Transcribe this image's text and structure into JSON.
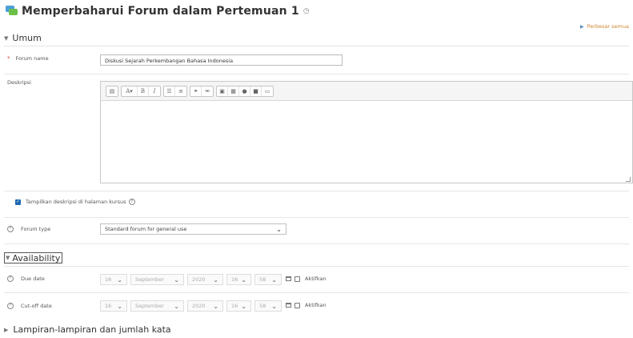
{
  "page": {
    "title": "Memperbaharui Forum dalam Pertemuan 1",
    "expand_all": "Perbesar semua"
  },
  "sections": {
    "general": {
      "label": "Umum"
    },
    "availability": {
      "label": "Availability"
    },
    "attachments": {
      "label": "Lampiran-lampiran dan jumlah kata"
    }
  },
  "form": {
    "forum_name": {
      "label": "Forum name",
      "value": "Diskusi Sejarah Perkembangan Bahasa Indonesia"
    },
    "description": {
      "label": "Deskripsi"
    },
    "show_description": {
      "label": "Tampilkan deskripsi di halaman kursus",
      "checked": true
    },
    "forum_type": {
      "label": "Forum type",
      "value": "Standard forum for general use"
    },
    "due_date": {
      "label": "Due date",
      "day": "16",
      "month": "September",
      "year": "2020",
      "hour": "16",
      "minute": "58",
      "enable_label": "Aktifkan",
      "enabled": false
    },
    "cutoff_date": {
      "label": "Cut-off date",
      "day": "16",
      "month": "September",
      "year": "2020",
      "hour": "16",
      "minute": "58",
      "enable_label": "Aktifkan",
      "enabled": false
    }
  },
  "editor_toolbar": {
    "groups": [
      [
        "toolbar-toggle-icon"
      ],
      [
        "font-style-icon",
        "bold-icon",
        "italic-icon"
      ],
      [
        "unordered-list-icon",
        "ordered-list-icon"
      ],
      [
        "link-icon",
        "unlink-icon"
      ],
      [
        "image-icon",
        "media-icon",
        "record-audio-icon",
        "record-video-icon",
        "manage-files-icon"
      ]
    ],
    "text": {
      "font_style": "A",
      "bold": "B",
      "italic": "I"
    }
  },
  "colors": {
    "required": "#d43f3a",
    "link": "#d0852e",
    "checkbox": "#1d69b4"
  }
}
